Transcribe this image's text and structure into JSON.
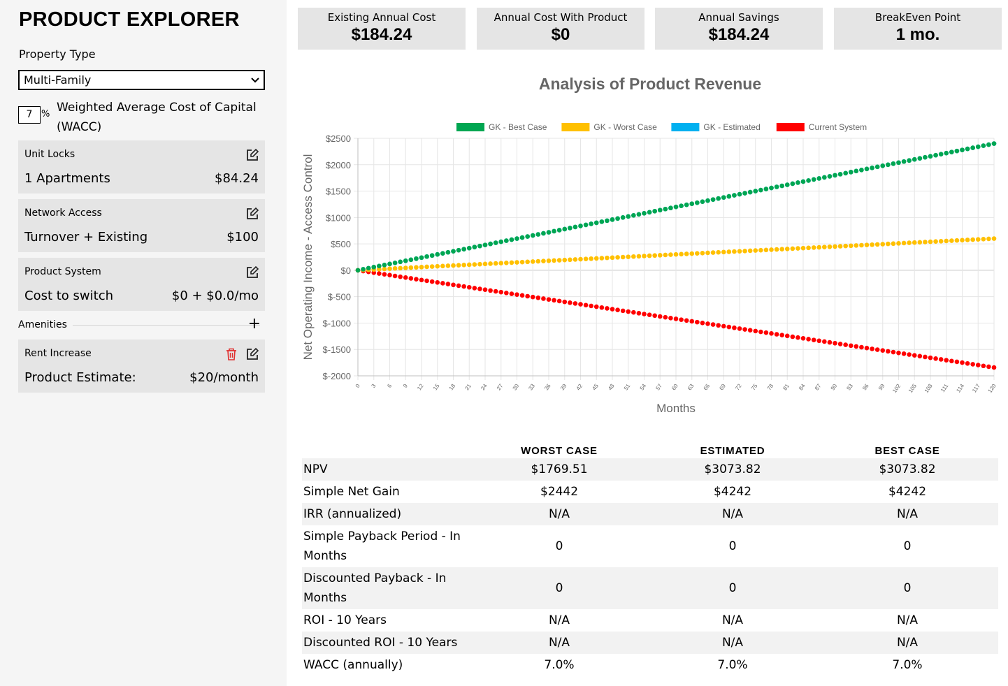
{
  "sidebar": {
    "title": "PRODUCT EXPLORER",
    "property_type_label": "Property Type",
    "property_type_value": "Multi-Family",
    "wacc_value": "7",
    "wacc_pct": "%",
    "wacc_label": "Weighted Average Cost of Capital (WACC)",
    "cards": [
      {
        "title": "Unit Locks",
        "left": "1 Apartments",
        "right": "$84.24"
      },
      {
        "title": "Network Access",
        "left": "Turnover + Existing",
        "right": "$100"
      },
      {
        "title": "Product System",
        "left": "Cost to switch",
        "right": "$0 + $0.0/mo"
      }
    ],
    "amenities_label": "Amenities",
    "amenities_add": "+",
    "amenity_card": {
      "title": "Rent Increase",
      "left": "Product Estimate:",
      "right": "$20/month"
    }
  },
  "stats": [
    {
      "label": "Existing Annual Cost",
      "value": "$184.24"
    },
    {
      "label": "Annual Cost With Product",
      "value": "$0"
    },
    {
      "label": "Annual Savings",
      "value": "$184.24"
    },
    {
      "label": "BreakEven Point",
      "value": "1 mo."
    }
  ],
  "chart_data": {
    "type": "line",
    "title": "Analysis of Product Revenue",
    "xlabel": "Months",
    "ylabel": "Net Operating Income - Access Control",
    "xlim": [
      0,
      120
    ],
    "ylim": [
      -2000,
      2500
    ],
    "ytick_step": 500,
    "ytick_format": "$",
    "xtick_step": 3,
    "grid": true,
    "legend_position": "top",
    "series": [
      {
        "name": "GK - Best Case",
        "color": "#00a651",
        "start": 0,
        "end": 2400
      },
      {
        "name": "GK - Worst Case",
        "color": "#ffc000",
        "start": 0,
        "end": 600
      },
      {
        "name": "GK - Estimated",
        "color": "#00b0f0",
        "start": 0,
        "end": 2400
      },
      {
        "name": "Current System",
        "color": "#ff0000",
        "start": 0,
        "end": -1842
      }
    ]
  },
  "metrics": {
    "headers": [
      "",
      "WORST CASE",
      "ESTIMATED",
      "BEST CASE"
    ],
    "rows": [
      {
        "label": "NPV",
        "values": [
          "$1769.51",
          "$3073.82",
          "$3073.82"
        ]
      },
      {
        "label": "Simple Net Gain",
        "values": [
          "$2442",
          "$4242",
          "$4242"
        ]
      },
      {
        "label": "IRR (annualized)",
        "values": [
          "N/A",
          "N/A",
          "N/A"
        ]
      },
      {
        "label": "Simple Payback Period - In Months",
        "values": [
          "0",
          "0",
          "0"
        ]
      },
      {
        "label": "Discounted Payback - In Months",
        "values": [
          "0",
          "0",
          "0"
        ]
      },
      {
        "label": "ROI - 10 Years",
        "values": [
          "N/A",
          "N/A",
          "N/A"
        ]
      },
      {
        "label": "Discounted ROI - 10 Years",
        "values": [
          "N/A",
          "N/A",
          "N/A"
        ]
      },
      {
        "label": "WACC (annually)",
        "values": [
          "7.0%",
          "7.0%",
          "7.0%"
        ]
      }
    ]
  },
  "colors": {
    "sidebar_bg": "#f5f5f5",
    "card_bg": "#e5e5e5",
    "trash": "#e03030"
  }
}
